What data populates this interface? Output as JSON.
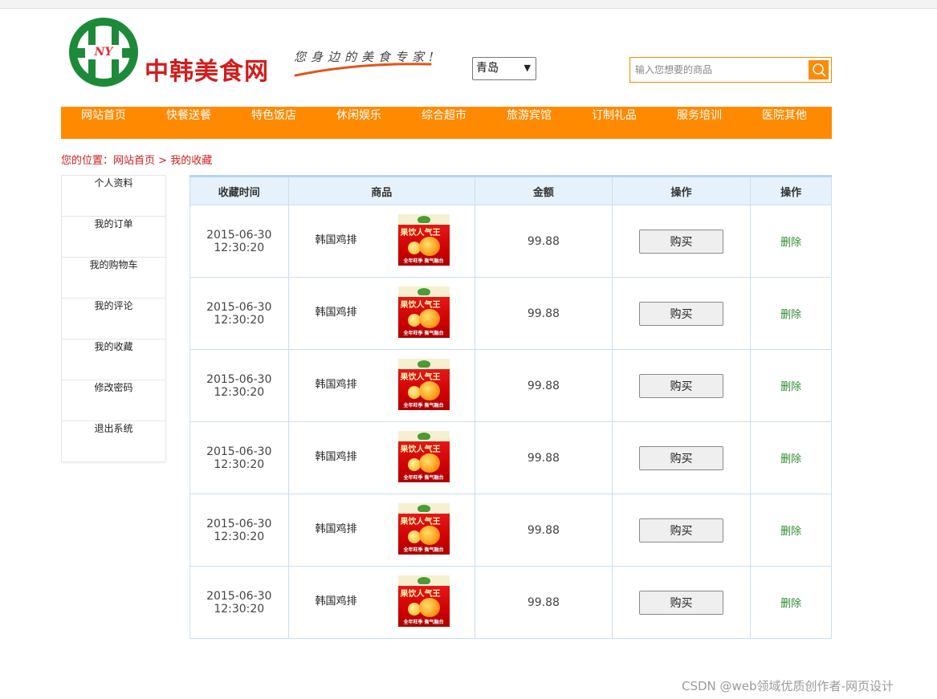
{
  "header": {
    "logo_mark": "NY",
    "logo_text": "中韩美食网",
    "slogan": "您身边的美食专家!",
    "city_select": {
      "selected": "青岛"
    },
    "search": {
      "placeholder": "输入您想要的商品"
    }
  },
  "nav": {
    "items": [
      "网站首页",
      "快餐送餐",
      "特色饭店",
      "休闲娱乐",
      "综合超市",
      "旅游宾馆",
      "订制礼品",
      "服务培训",
      "医院其他"
    ]
  },
  "breadcrumb": {
    "prefix": "您的位置：",
    "home": "网站首页",
    "separator": ">",
    "current": "我的收藏"
  },
  "sidebar": {
    "items": [
      "个人资料",
      "我的订单",
      "我的购物车",
      "我的评论",
      "我的收藏",
      "修改密码",
      "退出系统"
    ]
  },
  "table": {
    "headers": [
      "收藏时间",
      "商品",
      "金额",
      "操作",
      "操作"
    ],
    "product_image": {
      "title": "果饮人气王",
      "footer": "全年旺季 衡气融台"
    },
    "rows": [
      {
        "date": "2015-06-30",
        "time": "12:30:20",
        "product": "韩国鸡排",
        "price": "99.88",
        "buy": "购买",
        "delete": "删除"
      },
      {
        "date": "2015-06-30",
        "time": "12:30:20",
        "product": "韩国鸡排",
        "price": "99.88",
        "buy": "购买",
        "delete": "删除"
      },
      {
        "date": "2015-06-30",
        "time": "12:30:20",
        "product": "韩国鸡排",
        "price": "99.88",
        "buy": "购买",
        "delete": "删除"
      },
      {
        "date": "2015-06-30",
        "time": "12:30:20",
        "product": "韩国鸡排",
        "price": "99.88",
        "buy": "购买",
        "delete": "删除"
      },
      {
        "date": "2015-06-30",
        "time": "12:30:20",
        "product": "韩国鸡排",
        "price": "99.88",
        "buy": "购买",
        "delete": "删除"
      },
      {
        "date": "2015-06-30",
        "time": "12:30:20",
        "product": "韩国鸡排",
        "price": "99.88",
        "buy": "购买",
        "delete": "删除"
      }
    ]
  },
  "watermark": "CSDN @web领域优质创作者-网页设计",
  "colors": {
    "accent": "#ff8a00",
    "brand_green": "#1d8a3a",
    "brand_red": "#d21d1d",
    "delete_link": "#2e8b2e",
    "table_header_bg": "#e6f2fb"
  },
  "icons": {
    "search": "search-icon",
    "logo": "logo-ring-icon"
  }
}
